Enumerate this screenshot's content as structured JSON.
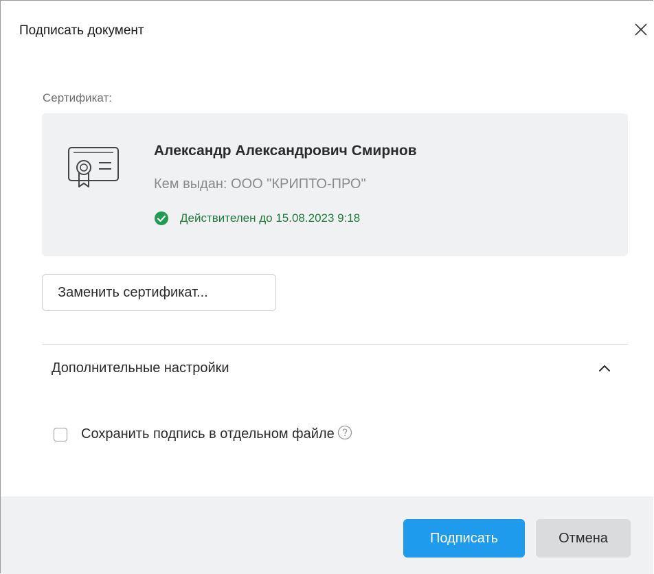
{
  "dialog": {
    "title": "Подписать документ",
    "close_icon": "close-icon"
  },
  "certificate": {
    "caption": "Сертификат:",
    "icon": "certificate-icon",
    "owner": "Александр Александрович Смирнов",
    "issuer": "Кем выдан: ООО \"КРИПТО-ПРО\"",
    "validity": "Действителен до 15.08.2023 9:18",
    "validity_icon": "check-circle-icon",
    "valid_color": "#1f7a3b",
    "replace_button": "Заменить сертификат..."
  },
  "advanced": {
    "label": "Дополнительные настройки",
    "chevron_icon": "chevron-up-icon",
    "expanded": true,
    "save_separate": {
      "label": "Сохранить подпись в отдельном файле",
      "checked": false,
      "help_icon": "help-icon"
    }
  },
  "footer": {
    "sign_button": "Подписать",
    "cancel_button": "Отмена",
    "accent_color": "#1e9bec"
  }
}
